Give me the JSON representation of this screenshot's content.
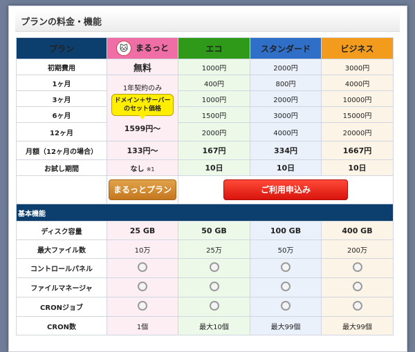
{
  "page": {
    "title": "プランの料金・機能"
  },
  "headers": {
    "plan": "プラン",
    "marutto": "まるっと",
    "mascot_icon": "cat-mascot-icon",
    "eco": "エコ",
    "standard": "スタンダード",
    "business": "ビジネス"
  },
  "rows": {
    "initial": {
      "label": "初期費用",
      "marutto": "無料",
      "eco": "1000円",
      "standard": "2000円",
      "business": "3000円"
    },
    "m1": {
      "label": "1ヶ月",
      "eco": "400円",
      "standard": "800円",
      "business": "4000円"
    },
    "m3": {
      "label": "3ヶ月",
      "eco": "1000円",
      "standard": "2000円",
      "business": "10000円"
    },
    "m6": {
      "label": "6ヶ月",
      "eco": "1500円",
      "standard": "3000円",
      "business": "15000円"
    },
    "m12": {
      "label": "12ヶ月",
      "eco": "2000円",
      "standard": "4000円",
      "business": "20000円"
    },
    "monthly": {
      "label": "月額（12ヶ月の場合）",
      "marutto": "133円～",
      "eco": "167円",
      "standard": "334円",
      "business": "1667円"
    },
    "trial": {
      "label": "お試し期間",
      "marutto": "なし",
      "marutto_note": "※1",
      "eco": "10日",
      "standard": "10日",
      "business": "10日"
    }
  },
  "marutto_merged": {
    "contract": "1年契約のみ",
    "badge_line1": "ドメイン＋サーバー",
    "badge_line2": "のセット価格",
    "price": "1599円～"
  },
  "buttons": {
    "marutto": "まるっとプラン",
    "apply": "ご利用申込み"
  },
  "section": {
    "basic": "基本機能"
  },
  "features": {
    "disk": {
      "label": "ディスク容量",
      "marutto": "25 GB",
      "eco": "50 GB",
      "standard": "100 GB",
      "business": "400 GB"
    },
    "maxfiles": {
      "label": "最大ファイル数",
      "marutto": "10万",
      "eco": "25万",
      "standard": "50万",
      "business": "200万"
    },
    "cpanel": {
      "label": "コントロールパネル",
      "icon": "circle-icon"
    },
    "filemgr": {
      "label": "ファイルマネージャ",
      "icon": "circle-icon"
    },
    "cron": {
      "label": "CRONジョブ",
      "icon": "circle-icon"
    },
    "croncount": {
      "label": "CRON数",
      "marutto": "1個",
      "eco": "最大10個",
      "standard": "最大99個",
      "business": "最大99個"
    }
  },
  "colors": {
    "header_plan": "#0c3e6e",
    "header_marutto": "#ef6ea6",
    "header_eco": "#2f9a1a",
    "header_standard": "#2f6fc7",
    "header_business": "#f29b1c",
    "free_text": "#e01a1a"
  }
}
